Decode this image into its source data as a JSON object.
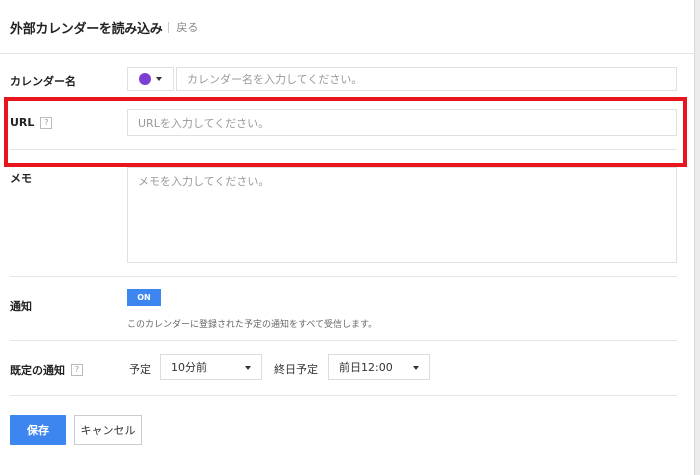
{
  "header": {
    "title": "外部カレンダーを読み込み",
    "back_label": "戻る"
  },
  "form": {
    "calendar_name": {
      "label": "カレンダー名",
      "placeholder": "カレンダー名を入力してください。",
      "color": "#7d3fd1"
    },
    "url": {
      "label": "URL",
      "help": "?",
      "placeholder": "URLを入力してください。"
    },
    "memo": {
      "label": "メモ",
      "placeholder": "メモを入力してください。"
    },
    "notification": {
      "label": "通知",
      "toggle_label": "ON",
      "description": "このカレンダーに登録された予定の通知をすべて受信します。"
    },
    "default_notification": {
      "label": "既定の通知",
      "help": "?",
      "event_label": "予定",
      "event_value": "10分前",
      "allday_label": "終日予定",
      "allday_value": "前日12:00"
    }
  },
  "actions": {
    "save_label": "保存",
    "cancel_label": "キャンセル"
  },
  "colors": {
    "accent": "#3d86f0",
    "highlight": "#e8141e",
    "calendar_color": "#7d3fd1"
  }
}
